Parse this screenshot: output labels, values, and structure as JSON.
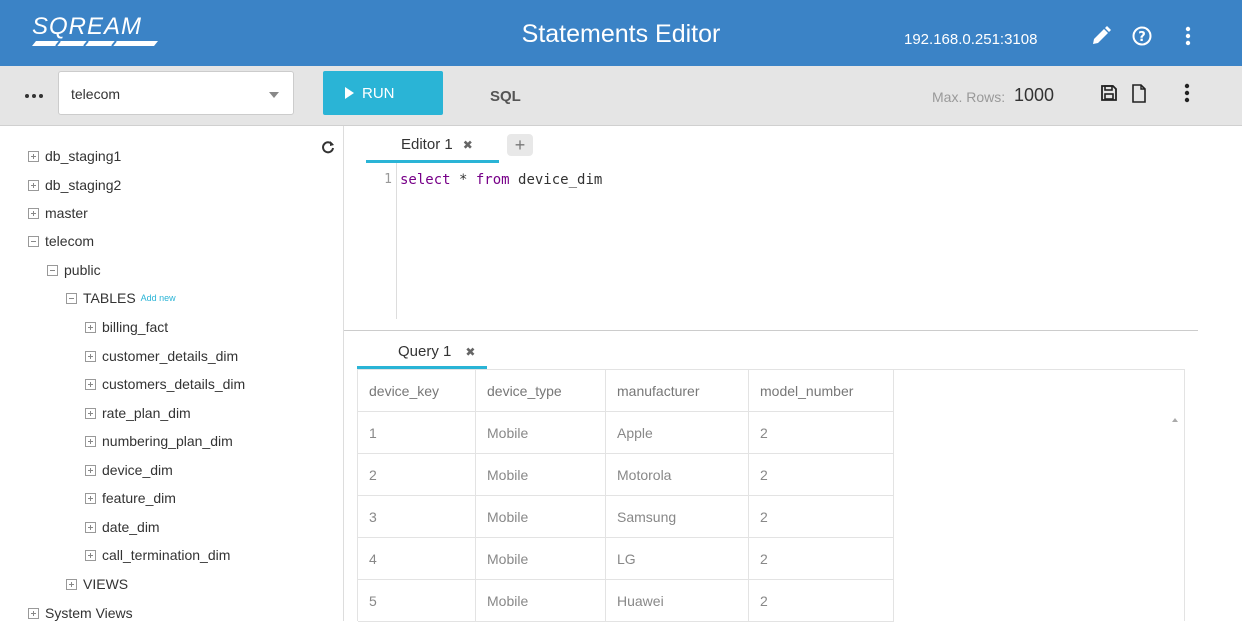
{
  "header": {
    "logo_text": "SQREAM",
    "title": "Statements Editor",
    "server": "192.168.0.251:3108",
    "icons": [
      "pencil-icon",
      "help-icon",
      "more-vertical-icon"
    ]
  },
  "toolbar": {
    "database": "telecom",
    "run_label": "RUN",
    "mode_label": "SQL",
    "max_rows_label": "Max. Rows:",
    "max_rows_value": "1000"
  },
  "sidebar": {
    "db1": "db_staging1",
    "db2": "db_staging2",
    "db3": "master",
    "db4": "telecom",
    "schema": "public",
    "tables_label": "TABLES",
    "add_new": "Add new",
    "tables": [
      "billing_fact",
      "customer_details_dim",
      "customers_details_dim",
      "rate_plan_dim",
      "numbering_plan_dim",
      "device_dim",
      "feature_dim",
      "date_dim",
      "call_termination_dim"
    ],
    "views_label": "VIEWS",
    "system_views": "System Views"
  },
  "editor": {
    "tab_label": "Editor 1",
    "line_number": "1",
    "code_kw1": "select",
    "code_mid": " * ",
    "code_kw2": "from",
    "code_rest": " device_dim"
  },
  "results": {
    "tab_label": "Query 1",
    "columns": [
      "device_key",
      "device_type",
      "manufacturer",
      "model_number"
    ],
    "rows": [
      [
        "1",
        "Mobile",
        "Apple",
        "2"
      ],
      [
        "2",
        "Mobile",
        "Motorola",
        "2"
      ],
      [
        "3",
        "Mobile",
        "Samsung",
        "2"
      ],
      [
        "4",
        "Mobile",
        "LG",
        "2"
      ],
      [
        "5",
        "Mobile",
        "Huawei",
        "2"
      ]
    ]
  },
  "colors": {
    "header_bg": "#3b83c6",
    "accent": "#2ab4d6",
    "toolbar_bg": "#e5e5e5"
  }
}
